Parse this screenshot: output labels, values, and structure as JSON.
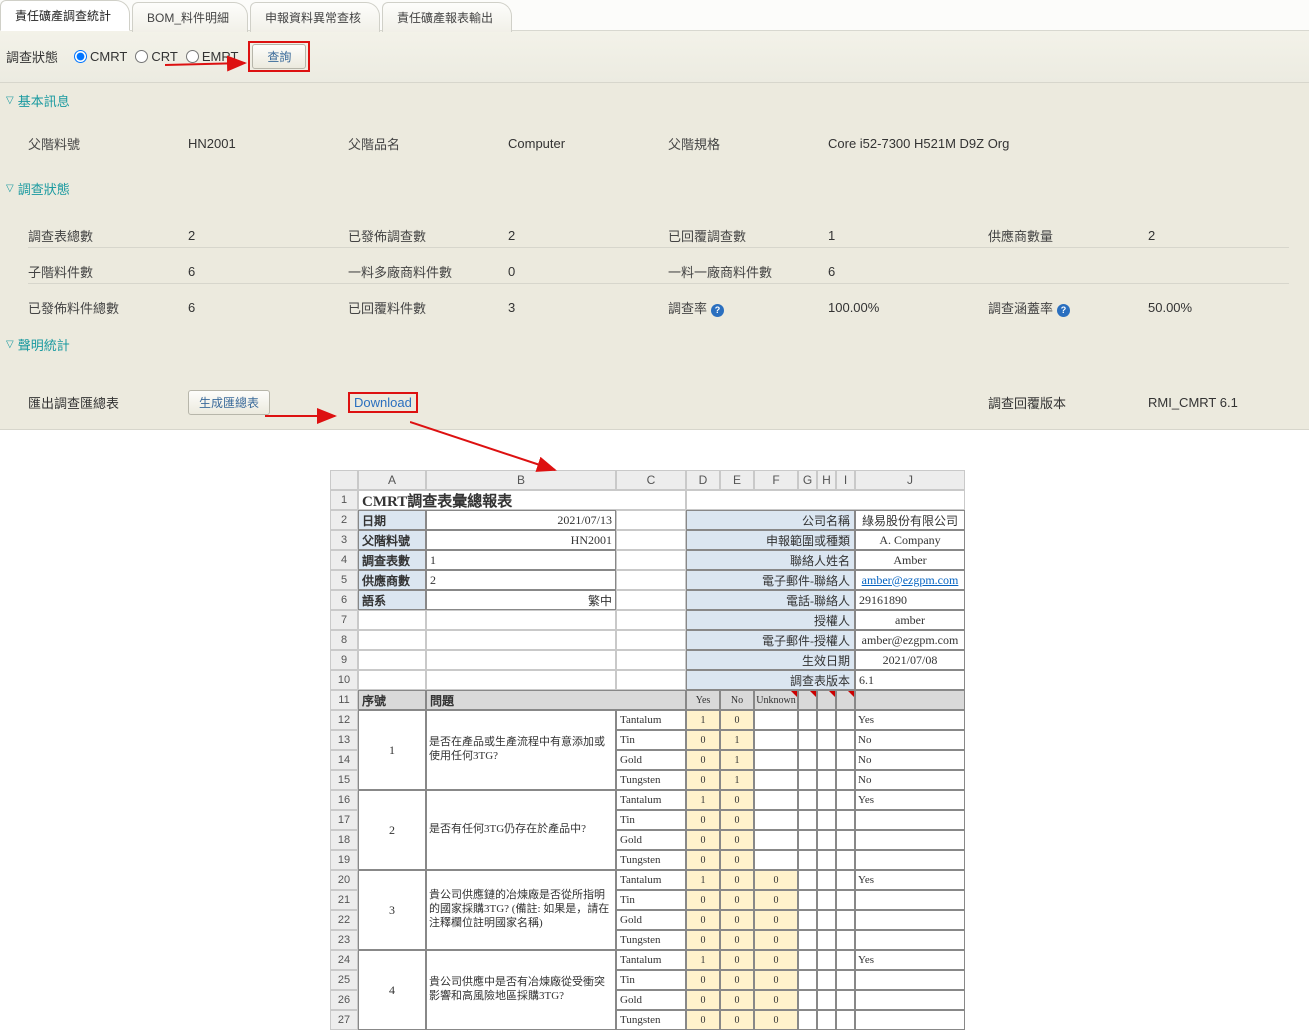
{
  "tabs": [
    "責任礦產調查統計",
    "BOM_料件明細",
    "申報資料異常查核",
    "責任礦產報表輸出"
  ],
  "filter": {
    "label": "調查狀態",
    "opts": [
      "CMRT",
      "CRT",
      "EMRT"
    ],
    "query": "查詢"
  },
  "section": {
    "basic": "基本訊息",
    "survey": "調查狀態",
    "stmt": "聲明統計"
  },
  "basic": {
    "l1": "父階料號",
    "v1": "HN2001",
    "l2": "父階品名",
    "v2": "Computer",
    "l3": "父階規格",
    "v3": "Core i52-7300 H521M D9Z Org"
  },
  "stats": {
    "r1": {
      "l1": "調查表總數",
      "v1": "2",
      "l2": "已發佈調查數",
      "v2": "2",
      "l3": "已回覆調查數",
      "v3": "1",
      "l4": "供應商數量",
      "v4": "2"
    },
    "r2": {
      "l1": "子階料件數",
      "v1": "6",
      "l2": "一料多廠商料件數",
      "v2": "0",
      "l3": "一料一廠商料件數",
      "v3": "6"
    },
    "r3": {
      "l1": "已發佈料件總數",
      "v1": "6",
      "l2": "已回覆料件數",
      "v2": "3",
      "l3": "調查率",
      "v3": "100.00%",
      "l4": "調查涵蓋率",
      "v4": "50.00%"
    }
  },
  "export": {
    "label": "匯出調查匯總表",
    "gen": "生成匯總表",
    "download": "Download",
    "verLabel": "調查回覆版本",
    "verVal": "RMI_CMRT 6.1"
  },
  "xl": {
    "cols": [
      "A",
      "B",
      "C",
      "D",
      "E",
      "F",
      "G",
      "H",
      "I",
      "J"
    ],
    "title": "CMRT調查表彙總報表",
    "left": {
      "date_l": "日期",
      "date_v": "2021/07/13",
      "pn_l": "父階料號",
      "pn_v": "HN2001",
      "cnt_l": "調查表數",
      "cnt_v": "1",
      "sup_l": "供應商數",
      "sup_v": "2",
      "lang_l": "語系",
      "lang_v": "繁中"
    },
    "right": {
      "company_l": "公司名稱",
      "company_v": "綠易股份有限公司",
      "scope_l": "申報範圍或種類",
      "scope_v": "A. Company",
      "contact_l": "聯絡人姓名",
      "contact_v": "Amber",
      "email_l": "電子郵件-聯絡人",
      "email_v": "amber@ezgpm.com",
      "tel_l": "電話-聯絡人",
      "tel_v": "29161890",
      "auth_l": "授權人",
      "auth_v": "amber",
      "aemail_l": "電子郵件-授權人",
      "aemail_v": "amber@ezgpm.com",
      "eff_l": "生效日期",
      "eff_v": "2021/07/08",
      "ver_l": "調查表版本",
      "ver_v": "6.1"
    },
    "th": {
      "seq": "序號",
      "q": "問題",
      "yes": "Yes",
      "no": "No",
      "unk": "Unknown"
    },
    "metals": [
      "Tantalum",
      "Tin",
      "Gold",
      "Tungsten"
    ],
    "q1": {
      "idx": "1",
      "text": "是否在產品或生產流程中有意添加或使用任何3TG?",
      "rows": [
        {
          "y": "1",
          "n": "0",
          "j": "Yes"
        },
        {
          "y": "0",
          "n": "1",
          "j": "No"
        },
        {
          "y": "0",
          "n": "1",
          "j": "No"
        },
        {
          "y": "0",
          "n": "1",
          "j": "No"
        }
      ]
    },
    "q2": {
      "idx": "2",
      "text": "是否有任何3TG仍存在於產品中?",
      "rows": [
        {
          "y": "1",
          "n": "0",
          "j": "Yes"
        },
        {
          "y": "0",
          "n": "0",
          "j": ""
        },
        {
          "y": "0",
          "n": "0",
          "j": ""
        },
        {
          "y": "0",
          "n": "0",
          "j": ""
        }
      ]
    },
    "q3": {
      "idx": "3",
      "text": "貴公司供應鏈的冶煉廠是否從所指明的國家採購3TG? (備註: 如果是，請在注釋欄位註明國家名稱)",
      "rows": [
        {
          "y": "1",
          "n": "0",
          "u": "0",
          "j": "Yes"
        },
        {
          "y": "0",
          "n": "0",
          "u": "0",
          "j": ""
        },
        {
          "y": "0",
          "n": "0",
          "u": "0",
          "j": ""
        },
        {
          "y": "0",
          "n": "0",
          "u": "0",
          "j": ""
        }
      ]
    },
    "q4": {
      "idx": "4",
      "text": "貴公司供應中是否有冶煉廠從受衝突影響和高風險地區採購3TG?",
      "rows": [
        {
          "y": "1",
          "n": "0",
          "u": "0",
          "j": "Yes"
        },
        {
          "y": "0",
          "n": "0",
          "u": "0",
          "j": ""
        },
        {
          "y": "0",
          "n": "0",
          "u": "0",
          "j": ""
        },
        {
          "y": "0",
          "n": "0",
          "u": "0",
          "j": ""
        }
      ]
    }
  }
}
